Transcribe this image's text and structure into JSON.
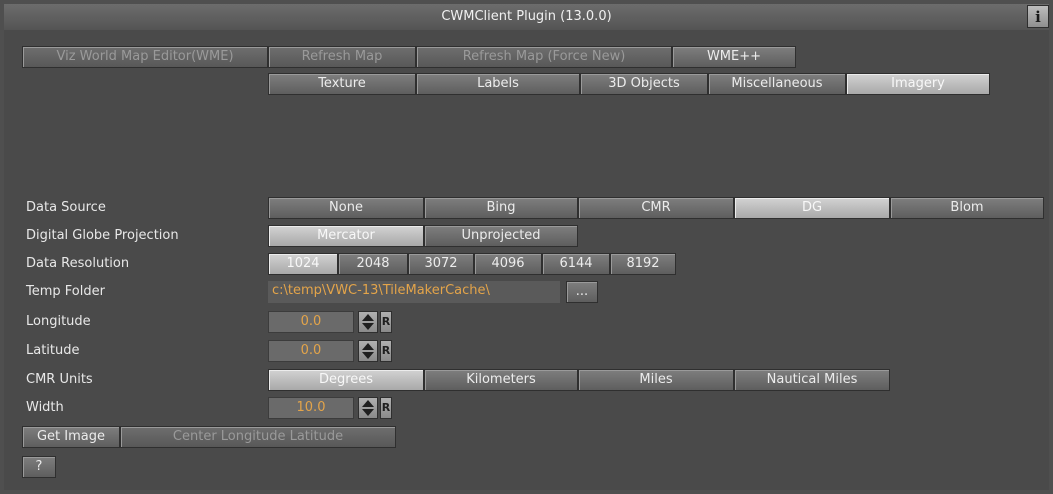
{
  "title": "CWMClient Plugin (13.0.0)",
  "info_label": "i",
  "top_buttons": [
    "Viz World Map Editor(WME)",
    "Refresh Map",
    "Refresh Map (Force New)",
    "WME++"
  ],
  "tabs": [
    "Texture",
    "Labels",
    "3D Objects",
    "Miscellaneous",
    "Imagery"
  ],
  "active_tab": "Imagery",
  "data_source": {
    "label": "Data Source",
    "options": [
      "None",
      "Bing",
      "CMR",
      "DG",
      "Blom"
    ],
    "selected": "DG"
  },
  "projection": {
    "label": "Digital Globe Projection",
    "options": [
      "Mercator",
      "Unprojected"
    ],
    "selected": "Mercator"
  },
  "resolution": {
    "label": "Data Resolution",
    "options": [
      "1024",
      "2048",
      "3072",
      "4096",
      "6144",
      "8192"
    ],
    "selected": "1024"
  },
  "temp_folder": {
    "label": "Temp Folder",
    "value": "c:\\temp\\VWC-13\\TileMakerCache\\",
    "browse_label": "..."
  },
  "longitude": {
    "label": "Longitude",
    "value": "0.0",
    "reset": "R"
  },
  "latitude": {
    "label": "Latitude",
    "value": "0.0",
    "reset": "R"
  },
  "cmr_units": {
    "label": "CMR Units",
    "options": [
      "Degrees",
      "Kilometers",
      "Miles",
      "Nautical Miles"
    ],
    "selected": "Degrees"
  },
  "width": {
    "label": "Width",
    "value": "10.0",
    "reset": "R"
  },
  "get_image_label": "Get Image",
  "center_label": "Center Longitude Latitude",
  "help_label": "?",
  "colors": {
    "value_text": "#e3a44a",
    "panel": "#4a4a4a"
  }
}
